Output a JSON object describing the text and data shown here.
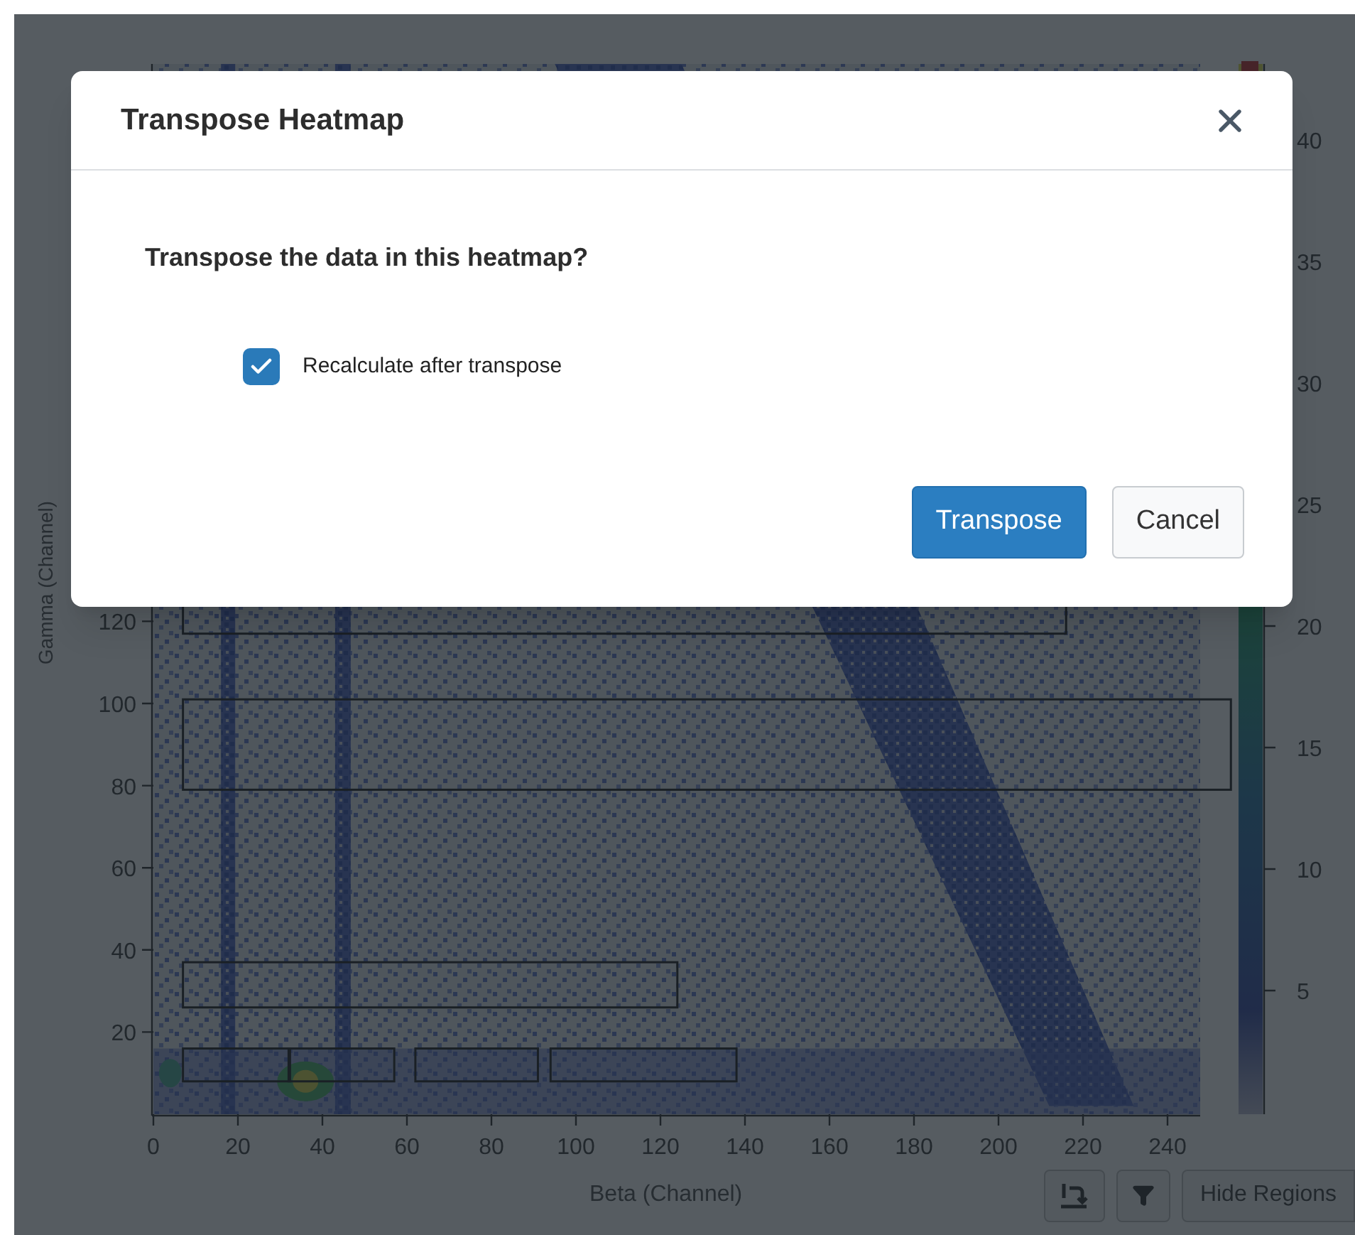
{
  "plot": {
    "y_axis_label": "Gamma (Channel)",
    "x_axis_label": "Beta (Channel)",
    "y_ticks": [
      "120",
      "100",
      "80",
      "60",
      "40",
      "20"
    ],
    "x_ticks": [
      "0",
      "20",
      "40",
      "60",
      "80",
      "100",
      "120",
      "140",
      "160",
      "180",
      "200",
      "220",
      "240"
    ],
    "colorbar_ticks": [
      "40",
      "35",
      "30",
      "25",
      "20",
      "15",
      "10",
      "5"
    ]
  },
  "toolbar": {
    "hide_regions_label": "Hide Regions"
  },
  "dialog": {
    "title": "Transpose Heatmap",
    "question": "Transpose the data in this heatmap?",
    "checkbox": {
      "label": "Recalculate after transpose",
      "checked": true
    },
    "buttons": [
      {
        "label": "Transpose",
        "kind": "primary"
      },
      {
        "label": "Cancel",
        "kind": "secondary"
      }
    ]
  }
}
